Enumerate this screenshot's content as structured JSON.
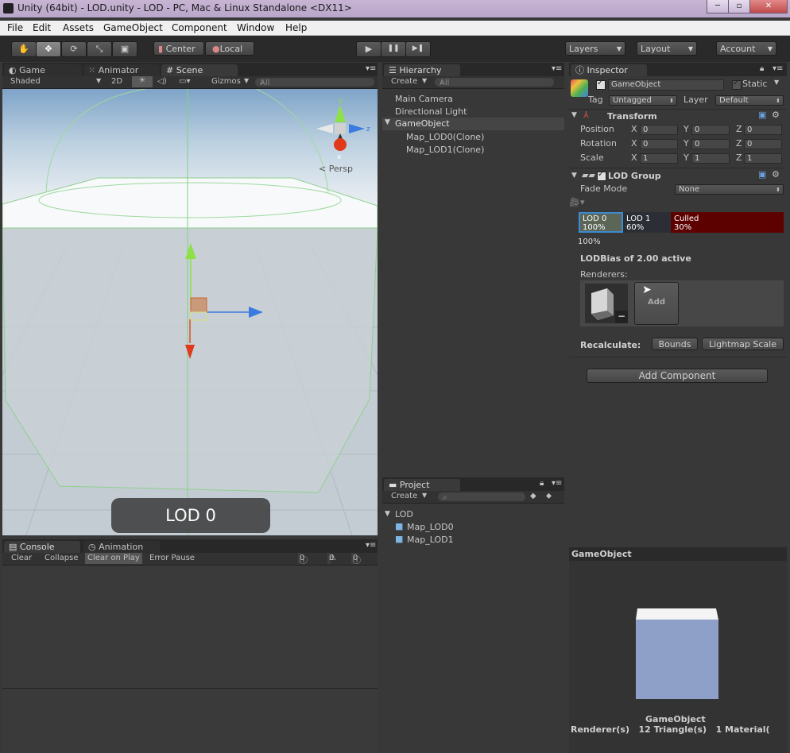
{
  "window": {
    "title": "Unity (64bit) - LOD.unity - LOD - PC, Mac & Linux Standalone <DX11>",
    "min": "─",
    "max": "▫",
    "close": "✕"
  },
  "menu": [
    "File",
    "Edit",
    "Assets",
    "GameObject",
    "Component",
    "Window",
    "Help"
  ],
  "toolbar": {
    "tools": [
      "hand-icon",
      "move-icon",
      "rotate-icon",
      "scale-icon",
      "rect-icon"
    ],
    "pivot_center": "Center",
    "pivot_local": "Local",
    "play": "▶",
    "pause": "❚❚",
    "step": "▶❚",
    "layers": "Layers",
    "layout": "Layout",
    "account": "Account"
  },
  "scene_panel": {
    "tabs": [
      "Game",
      "Animator",
      "Scene"
    ],
    "shading": "Shaded",
    "mode_2d": "2D",
    "gizmos": "Gizmos",
    "search_placeholder": "All",
    "persp": "Persp",
    "lod_label": "LOD 0",
    "axis_x": "x",
    "axis_y": "y",
    "axis_z": "z"
  },
  "hierarchy": {
    "tab": "Hierarchy",
    "create": "Create",
    "search_placeholder": "All",
    "items": [
      "Main Camera",
      "Directional Light",
      "GameObject",
      "Map_LOD0(Clone)",
      "Map_LOD1(Clone)"
    ]
  },
  "project": {
    "tab": "Project",
    "create": "Create",
    "items": [
      "LOD",
      "Map_LOD0",
      "Map_LOD1"
    ]
  },
  "console": {
    "tabs": [
      "Console",
      "Animation"
    ],
    "buttons": [
      "Clear",
      "Collapse",
      "Clear on Play",
      "Error Pause"
    ],
    "counts": [
      "0",
      "0",
      "0"
    ]
  },
  "inspector": {
    "tab": "Inspector",
    "object_name": "GameObject",
    "static_label": "Static",
    "tag_label": "Tag",
    "tag_value": "Untagged",
    "layer_label": "Layer",
    "layer_value": "Default",
    "transform": {
      "title": "Transform",
      "rows": [
        {
          "label": "Position",
          "x": "0",
          "y": "0",
          "z": "0"
        },
        {
          "label": "Rotation",
          "x": "0",
          "y": "0",
          "z": "0"
        },
        {
          "label": "Scale",
          "x": "1",
          "y": "1",
          "z": "1"
        }
      ],
      "axis": [
        "X",
        "Y",
        "Z"
      ]
    },
    "lod_group": {
      "title": "LOD Group",
      "fade_mode_label": "Fade Mode",
      "fade_mode_value": "None",
      "bands": [
        {
          "name": "LOD 0",
          "pct": "100%",
          "color": "#5a6a5a"
        },
        {
          "name": "LOD 1",
          "pct": "60%",
          "color": "#2e3238"
        },
        {
          "name": "Culled",
          "pct": "30%",
          "color": "#5c0000"
        }
      ],
      "current_pct": "100%",
      "lod_bias": "LODBias of 2.00 active",
      "renderers_label": "Renderers:",
      "remove": "−",
      "add": "Add",
      "recalculate": "Recalculate:",
      "bounds": "Bounds",
      "lightmap_scale": "Lightmap Scale"
    },
    "add_component": "Add Component"
  },
  "preview": {
    "title": "GameObject",
    "caption": "GameObject",
    "stats": "Renderer(s)   12 Triangle(s)   1 Material("
  }
}
